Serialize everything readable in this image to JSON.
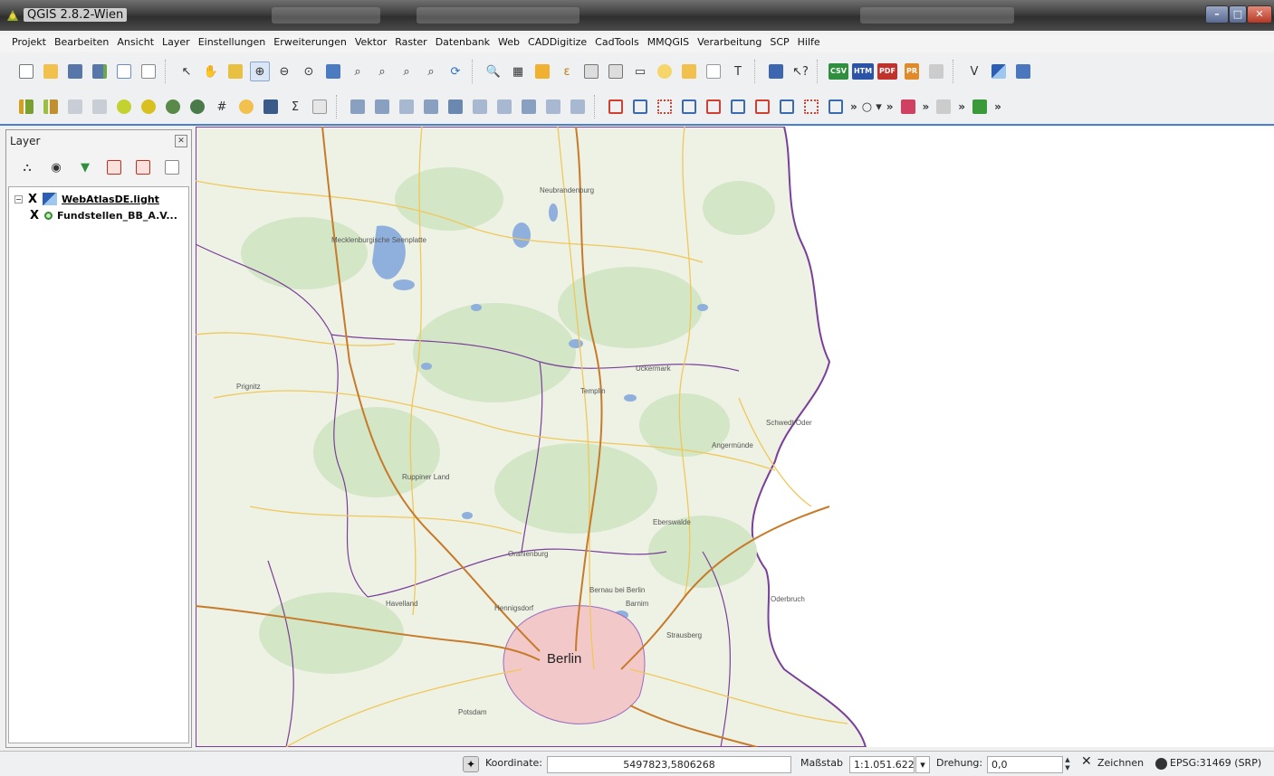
{
  "window": {
    "title": "QGIS 2.8.2-Wien"
  },
  "menu": [
    "Projekt",
    "Bearbeiten",
    "Ansicht",
    "Layer",
    "Einstellungen",
    "Erweiterungen",
    "Vektor",
    "Raster",
    "Datenbank",
    "Web",
    "CADDigitize",
    "CadTools",
    "MMQGIS",
    "Verarbeitung",
    "SCP",
    "Hilfe"
  ],
  "toolbar": {
    "csv_label": "CSV",
    "htm_label": "HTM",
    "pdf_label": "PDF",
    "pr_label": "PR",
    "more_label": "»"
  },
  "layers_panel": {
    "title": "Layer",
    "layers": [
      {
        "name": "WebAtlasDE.light",
        "type": "raster",
        "visible_mark": "X"
      },
      {
        "name": "Fundstellen_BB_A.V...",
        "type": "point",
        "visible_mark": "X"
      }
    ]
  },
  "map": {
    "labels": [
      "Neubrandenburg",
      "Mecklenburgische Seenplatte",
      "Prignitz",
      "Uckermark",
      "Ruppiner Land",
      "Oranienburg",
      "Eberswalde",
      "Havelland",
      "Barnim",
      "Berlin",
      "Potsdam",
      "Schwedt/Oder",
      "Oderbruch",
      "Strausberg",
      "Bernau bei Berlin",
      "Hennigsdorf",
      "Angermünde",
      "Templin"
    ],
    "colors": {
      "land": "#eef2e4",
      "forest": "#cfe3c4",
      "water": "#8fb0dc",
      "road_major": "#c77a2a",
      "road_minor": "#f0c75a",
      "border": "#7a3f9a",
      "urban": "#f2c8c8"
    }
  },
  "status": {
    "coordinate_label": "Koordinate:",
    "coordinate_value": "5497823,5806268",
    "scale_label": "Maßstab",
    "scale_value": "1:1.051.622",
    "rotation_label": "Drehung:",
    "rotation_value": "0,0",
    "render_label": "Zeichnen",
    "crs_label": "EPSG:31469 (SRP)"
  }
}
